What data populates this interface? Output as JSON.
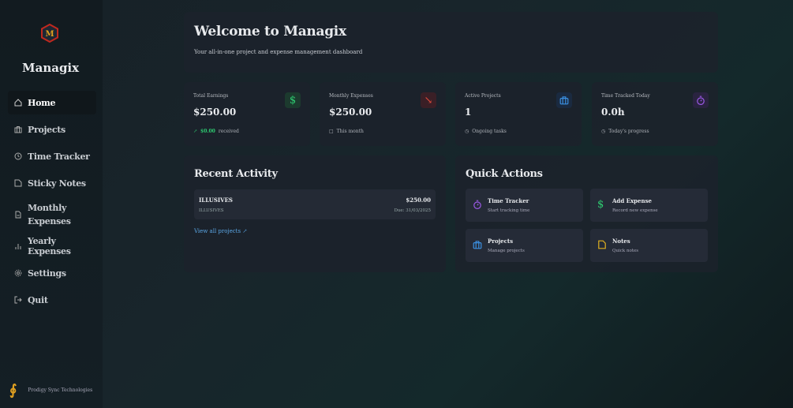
{
  "sidebar": {
    "brand": "Managix",
    "items": [
      {
        "label": "Home",
        "icon": "home-icon"
      },
      {
        "label": "Projects",
        "icon": "briefcase-icon"
      },
      {
        "label": "Time Tracker",
        "icon": "clock-icon"
      },
      {
        "label": "Sticky Notes",
        "icon": "note-icon"
      },
      {
        "label": "Monthly Expenses",
        "icon": "file-icon"
      },
      {
        "label": "Yearly Expenses",
        "icon": "bar-chart-icon"
      },
      {
        "label": "Settings",
        "icon": "gear-icon"
      },
      {
        "label": "Quit",
        "icon": "logout-icon"
      }
    ],
    "footer": "Prodigy Sync Technologies"
  },
  "welcome": {
    "title": "Welcome to Managix",
    "subtitle": "Your all-in-one project and expense management dashboard"
  },
  "stats": [
    {
      "label": "Total Earnings",
      "value": "$250.00",
      "sub_highlight": "$0.00",
      "sub": "received",
      "color": "#2ecc71"
    },
    {
      "label": "Monthly Expenses",
      "value": "$250.00",
      "sub": "This month",
      "color": "#e74c3c"
    },
    {
      "label": "Active Projects",
      "value": "1",
      "sub": "Ongoing tasks",
      "color": "#3b8fe0"
    },
    {
      "label": "Time Tracked Today",
      "value": "0.0h",
      "sub": "Today's progress",
      "color": "#9b59e6"
    }
  ],
  "recent": {
    "title": "Recent Activity",
    "items": [
      {
        "name": "ILLUSIVES",
        "client": "ILLUSIVES",
        "amount": "$250.00",
        "due": "Due: 31/03/2025"
      }
    ],
    "link": "View all projects"
  },
  "quick": {
    "title": "Quick Actions",
    "items": [
      {
        "title": "Time Tracker",
        "sub": "Start tracking time"
      },
      {
        "title": "Add Expense",
        "sub": "Record new expense"
      },
      {
        "title": "Projects",
        "sub": "Manage projects"
      },
      {
        "title": "Notes",
        "sub": "Quick notes"
      }
    ]
  }
}
